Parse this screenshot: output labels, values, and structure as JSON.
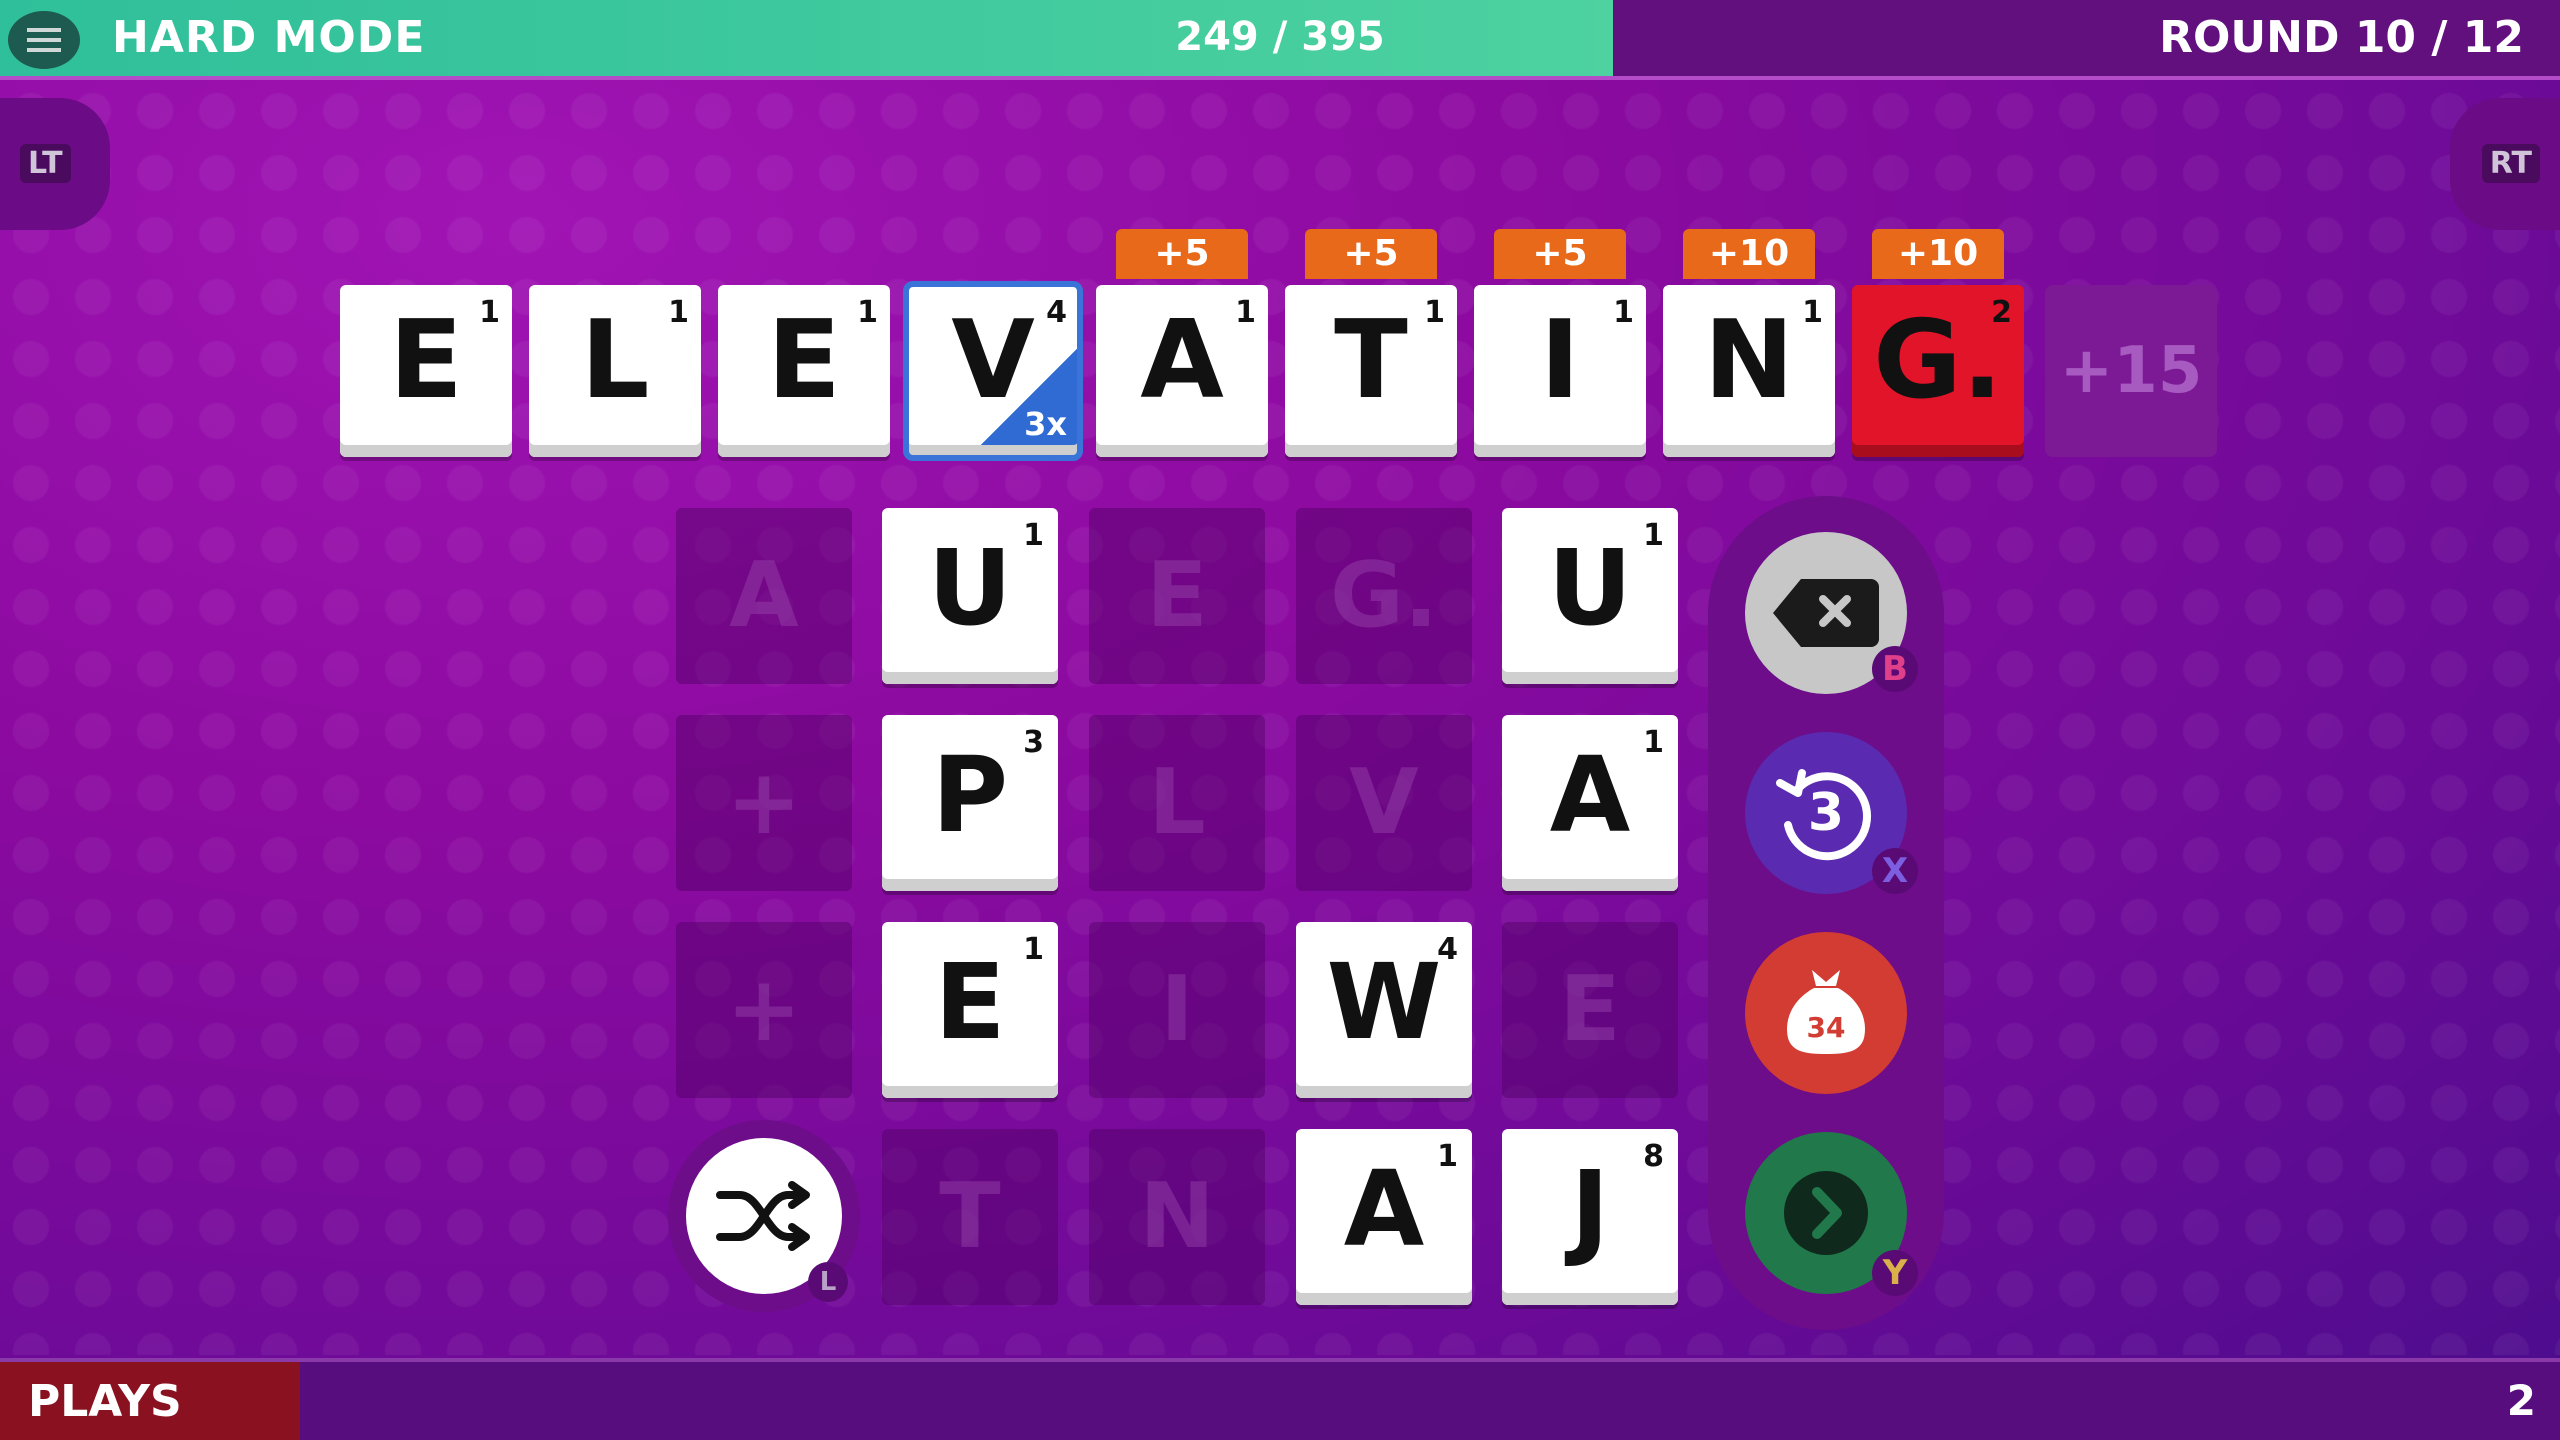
{
  "header": {
    "mode": "HARD MODE",
    "score": "249 / 395",
    "score_progress": 0.63,
    "round": "ROUND 10 / 12"
  },
  "shoulders": {
    "left": "LT",
    "right": "RT"
  },
  "word": {
    "tiles": [
      {
        "letter": "E",
        "points": "1"
      },
      {
        "letter": "L",
        "points": "1"
      },
      {
        "letter": "E",
        "points": "1"
      },
      {
        "letter": "V",
        "points": "4",
        "multiplier": "3x"
      },
      {
        "letter": "A",
        "points": "1",
        "bonus": "+5"
      },
      {
        "letter": "T",
        "points": "1",
        "bonus": "+5"
      },
      {
        "letter": "I",
        "points": "1",
        "bonus": "+5"
      },
      {
        "letter": "N",
        "points": "1",
        "bonus": "+10"
      },
      {
        "letter": "G.",
        "points": "2",
        "bonus": "+10"
      }
    ],
    "next_bonus": "+15"
  },
  "grid": {
    "row1": {
      "c0": "A",
      "c1": {
        "letter": "U",
        "points": "1"
      },
      "c2": "E",
      "c3": "G.",
      "c4": {
        "letter": "U",
        "points": "1"
      }
    },
    "row2": {
      "c0": "+",
      "c1": {
        "letter": "P",
        "points": "3"
      },
      "c2": "L",
      "c3": "V",
      "c4": {
        "letter": "A",
        "points": "1"
      }
    },
    "row3": {
      "c0": "+",
      "c1": {
        "letter": "E",
        "points": "1"
      },
      "c2": "I",
      "c3": {
        "letter": "W",
        "points": "4"
      },
      "c4": "E"
    },
    "row4": {
      "c1": "T",
      "c2": "N",
      "c3": {
        "letter": "A",
        "points": "1"
      },
      "c4": {
        "letter": "J",
        "points": "8"
      }
    }
  },
  "controls": {
    "delete_hint": "B",
    "undo_count": "3",
    "undo_hint": "X",
    "bag_count": "34",
    "submit_hint": "Y",
    "shuffle_hint": "L"
  },
  "colors": {
    "progress": "#3fca9d",
    "delete": "#c7c7c7",
    "undo": "#5a2bb0",
    "bag": "#d23c32",
    "submit": "#21784a",
    "bonus": "#e8691a",
    "selected_tile": "#e2142a",
    "multiplier": "#2f6bd2"
  },
  "footer": {
    "label": "PLAYS",
    "count": "2"
  }
}
